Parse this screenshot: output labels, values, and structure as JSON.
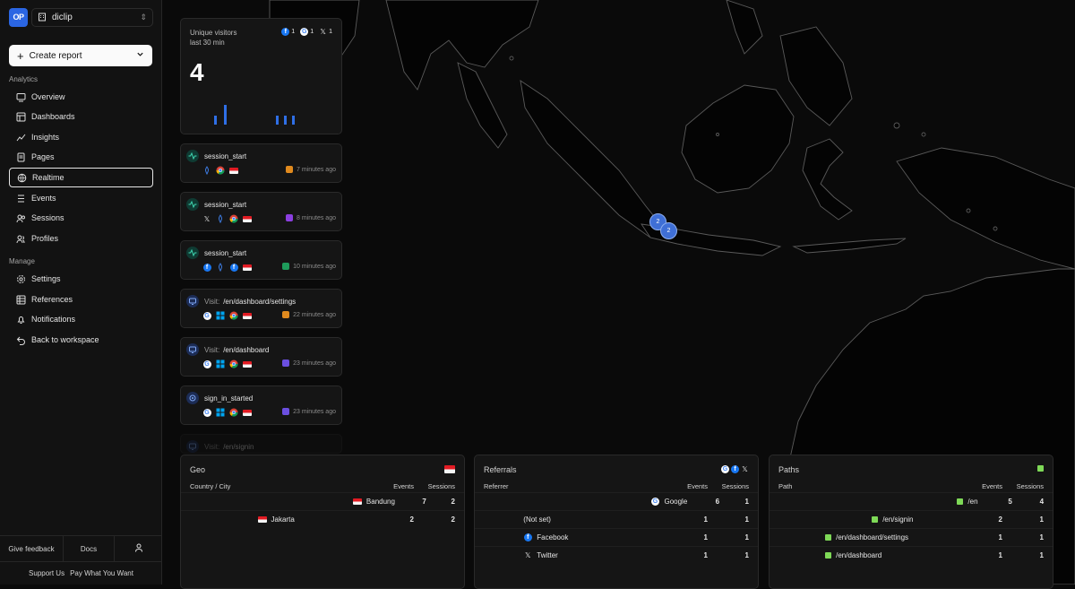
{
  "workspace": {
    "logo": "OP",
    "name": "diclip"
  },
  "create_report": {
    "label": "Create report"
  },
  "sidebar": {
    "analytics_label": "Analytics",
    "analytics": [
      {
        "label": "Overview",
        "icon": "overview-icon"
      },
      {
        "label": "Dashboards",
        "icon": "dashboards-icon"
      },
      {
        "label": "Insights",
        "icon": "insights-icon"
      },
      {
        "label": "Pages",
        "icon": "pages-icon"
      },
      {
        "label": "Realtime",
        "icon": "globe-icon",
        "active": true
      },
      {
        "label": "Events",
        "icon": "events-icon"
      },
      {
        "label": "Sessions",
        "icon": "sessions-icon"
      },
      {
        "label": "Profiles",
        "icon": "profiles-icon"
      }
    ],
    "manage_label": "Manage",
    "manage": [
      {
        "label": "Settings",
        "icon": "gear-icon"
      },
      {
        "label": "References",
        "icon": "references-icon"
      },
      {
        "label": "Notifications",
        "icon": "bell-icon"
      },
      {
        "label": "Back to workspace",
        "icon": "back-icon"
      }
    ],
    "footer": {
      "feedback": "Give feedback",
      "docs": "Docs",
      "support": "Support Us",
      "pay": "Pay What You Want"
    }
  },
  "visitors": {
    "title": "Unique visitors",
    "subtitle": "last 30 min",
    "count": "4",
    "referrers": [
      {
        "icon": "facebook-icon",
        "count": "1"
      },
      {
        "icon": "google-icon",
        "count": "1"
      },
      {
        "icon": "x-icon",
        "count": "1"
      }
    ],
    "bars": [
      0.45,
      1.0,
      0.45,
      0.45,
      0.45
    ]
  },
  "map": {
    "clusters": [
      {
        "label": "2"
      },
      {
        "label": "2"
      }
    ]
  },
  "events": [
    {
      "name": "session_start",
      "visit": "",
      "time": "7 minutes ago",
      "kind": "session",
      "avatar": "#e08a1e",
      "icons": [
        "direct-icon",
        "chrome-icon",
        "flag-indonesia-icon"
      ]
    },
    {
      "name": "session_start",
      "visit": "",
      "time": "8 minutes ago",
      "kind": "session",
      "avatar": "#8b3fe0",
      "icons": [
        "x-icon",
        "direct-icon",
        "chrome-icon",
        "flag-indonesia-icon"
      ]
    },
    {
      "name": "session_start",
      "visit": "",
      "time": "10 minutes ago",
      "kind": "session",
      "avatar": "#1e9b5b",
      "icons": [
        "facebook-icon",
        "direct-icon",
        "facebook-icon",
        "flag-indonesia-icon"
      ]
    },
    {
      "name": "/en/dashboard/settings",
      "visit": "Visit:",
      "time": "22 minutes ago",
      "kind": "visit",
      "avatar": "#e08a1e",
      "icons": [
        "google-icon",
        "windows-icon",
        "chrome-icon",
        "flag-indonesia-icon"
      ]
    },
    {
      "name": "/en/dashboard",
      "visit": "Visit:",
      "time": "23 minutes ago",
      "kind": "visit",
      "avatar": "#6b4fe0",
      "icons": [
        "google-icon",
        "windows-icon",
        "chrome-icon",
        "flag-indonesia-icon"
      ]
    },
    {
      "name": "sign_in_started",
      "visit": "",
      "time": "23 minutes ago",
      "kind": "custom",
      "avatar": "#6b4fe0",
      "icons": [
        "google-icon",
        "windows-icon",
        "chrome-icon",
        "flag-indonesia-icon"
      ]
    },
    {
      "name": "/en/signin",
      "visit": "Visit:",
      "time": "",
      "kind": "visit",
      "avatar": "",
      "icons": []
    }
  ],
  "geo": {
    "title": "Geo",
    "col1": "Country / City",
    "col2": "Events",
    "col3": "Sessions",
    "rows": [
      {
        "label": "Bandung",
        "events": "7",
        "sessions": "2",
        "share": 1.0
      },
      {
        "label": "Jakarta",
        "events": "2",
        "sessions": "2",
        "share": 0.29
      }
    ]
  },
  "referrals": {
    "title": "Referrals",
    "col1": "Referrer",
    "col2": "Events",
    "col3": "Sessions",
    "rows": [
      {
        "label": "Google",
        "icon": "google-icon",
        "events": "6",
        "sessions": "1",
        "share": 1.0
      },
      {
        "label": "(Not set)",
        "icon": "",
        "events": "1",
        "sessions": "1",
        "share": 0.17
      },
      {
        "label": "Facebook",
        "icon": "facebook-icon",
        "events": "1",
        "sessions": "1",
        "share": 0.17
      },
      {
        "label": "Twitter",
        "icon": "x-icon",
        "events": "1",
        "sessions": "1",
        "share": 0.17
      }
    ]
  },
  "paths": {
    "title": "Paths",
    "col1": "Path",
    "col2": "Events",
    "col3": "Sessions",
    "rows": [
      {
        "label": "/en",
        "events": "5",
        "sessions": "4",
        "share": 1.0
      },
      {
        "label": "/en/signin",
        "events": "2",
        "sessions": "1",
        "share": 0.4
      },
      {
        "label": "/en/dashboard/settings",
        "events": "1",
        "sessions": "1",
        "share": 0.2
      },
      {
        "label": "/en/dashboard",
        "events": "1",
        "sessions": "1",
        "share": 0.2
      }
    ]
  }
}
